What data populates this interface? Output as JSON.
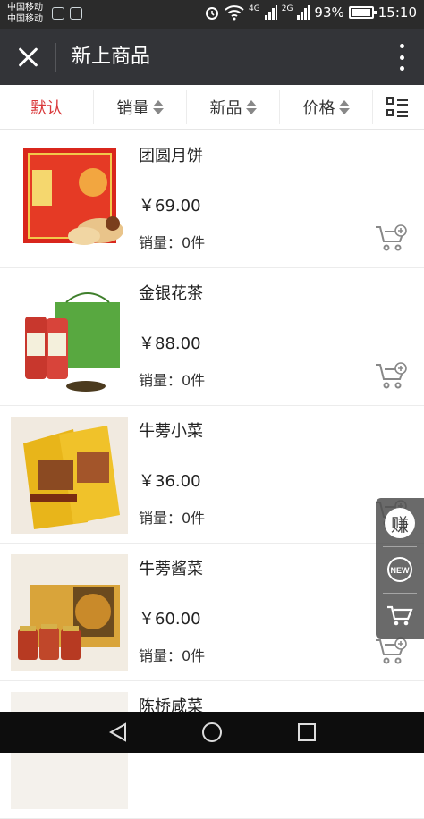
{
  "status_bar": {
    "carrier_1": "中国移动",
    "carrier_2": "中国移动",
    "network_1": "4G",
    "network_2": "2G",
    "battery": "93%",
    "time": "15:10"
  },
  "title_bar": {
    "title": "新上商品",
    "close_icon": "close-icon",
    "more_icon": "more-vertical-icon"
  },
  "sort_bar": {
    "default_label": "默认",
    "sales_label": "销量",
    "new_label": "新品",
    "price_label": "价格",
    "layout_icon": "grid-list-icon",
    "active_color": "#d9383a"
  },
  "products": [
    {
      "name": "团圆月饼",
      "price": "￥69.00",
      "sales": "销量：0件"
    },
    {
      "name": "金银花茶",
      "price": "￥88.00",
      "sales": "销量：0件"
    },
    {
      "name": "牛蒡小菜",
      "price": "￥36.00",
      "sales": "销量：0件"
    },
    {
      "name": "牛蒡酱菜",
      "price": "￥60.00",
      "sales": "销量：0件"
    },
    {
      "name": "陈桥咸菜",
      "price": "",
      "sales": ""
    }
  ],
  "floating_panel": {
    "earn_label": "赚",
    "new_badge": "NEW",
    "cart_icon": "shopping-cart-icon"
  }
}
